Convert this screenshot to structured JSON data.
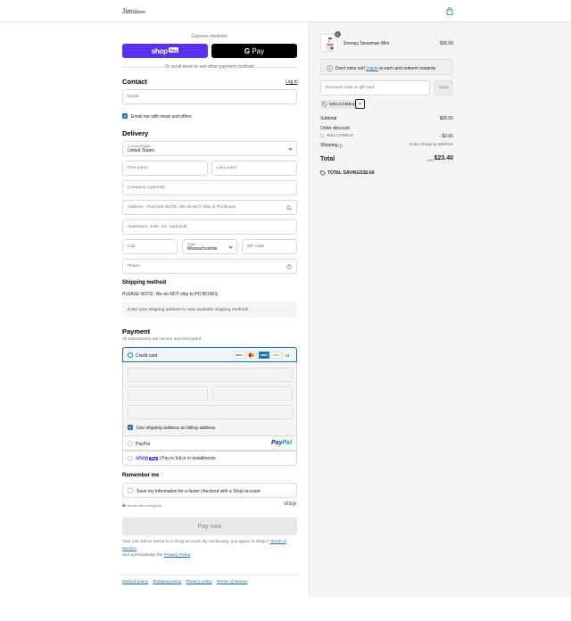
{
  "header": {
    "logo_main": "Jim",
    "logo_small": "Shore",
    "bag_icon": "shopping-bag-icon"
  },
  "express": {
    "label": "Express checkout",
    "shop_pay_label": "shop",
    "shop_pay_badge": "Pay",
    "gpay_g": "G",
    "gpay_label": " Pay",
    "divider_text": "Or scroll down to see other payment methods"
  },
  "contact": {
    "heading": "Contact",
    "login_link": "Log in",
    "email_placeholder": "Email",
    "newsletter_label": "Email me with news and offers",
    "newsletter_checked": true
  },
  "delivery": {
    "heading": "Delivery",
    "country_label": "Country/Region",
    "country_value": "United States",
    "first_name_placeholder": "First name",
    "last_name_placeholder": "Last name",
    "company_placeholder": "Company (optional)",
    "address_placeholder": "Address - PLEASE NOTE: We do NOT ship to PO Boxes",
    "apartment_placeholder": "Apartment, suite, etc. (optional)",
    "city_placeholder": "City",
    "state_label": "State",
    "state_value": "Massachusetts",
    "zip_placeholder": "ZIP code",
    "phone_placeholder": "Phone"
  },
  "shipping": {
    "heading": "Shipping method",
    "note": "PLEASE NOTE: We do NOT ship to PO BOXES",
    "placeholder_text": "Enter your shipping address to view available shipping methods."
  },
  "payment": {
    "heading": "Payment",
    "subtitle": "All transactions are secure and encrypted.",
    "credit_card_label": "Credit card",
    "card_brands": [
      "VISA",
      "MC",
      "AMEX",
      "DISC"
    ],
    "more_cards": "+3",
    "billing_same_label": "Use shipping address as billing address",
    "billing_same_checked": true,
    "paypal_label": "PayPal",
    "paypal_logo_1": "Pay",
    "paypal_logo_2": "Pal",
    "shoppay_logo": "shop",
    "shoppay_badge": "Pay",
    "shoppay_text": "| Pay in full or in installments"
  },
  "remember": {
    "heading": "Remember me",
    "save_label": "Save my information for a faster checkout with a Shop account",
    "secure_text": "Secure and encrypted",
    "shop_brand": "shop"
  },
  "pay_now_label": "Pay now",
  "legal": {
    "text_1": "Your info will be saved to a Shop account. By continuing, you agree to Shop's ",
    "terms_link": "Terms of Service",
    "text_2": "and acknowledge the ",
    "privacy_link": "Privacy Policy",
    "text_3": "."
  },
  "footer_links": [
    "Refund policy",
    "Shipping policy",
    "Privacy policy",
    "Terms of service"
  ],
  "summary": {
    "product_name": "Snoopy Snowman Mini",
    "product_price": "$26.00",
    "quantity": "1",
    "notice_text_1": "Don't miss out! ",
    "notice_link": "Log in",
    "notice_text_2": " to earn and redeem rewards",
    "discount_placeholder": "Discount code or gift card",
    "apply_label": "Apply",
    "applied_code": "WELCOME10",
    "subtotal_label": "Subtotal",
    "subtotal_value": "$26.00",
    "order_discount_label": "Order discount",
    "order_discount_code": "WELCOME10",
    "order_discount_value": "- $2.60",
    "shipping_label": "Shipping",
    "shipping_value": "Enter shipping address",
    "total_label": "Total",
    "currency": "USD",
    "total_value": "$23.40",
    "savings_label": "TOTAL SAVINGS",
    "savings_value": "$2.60"
  },
  "colors": {
    "accent": "#1773b0",
    "shop_purple": "#5a31f4",
    "sidebar_bg": "#f5f5f5"
  }
}
